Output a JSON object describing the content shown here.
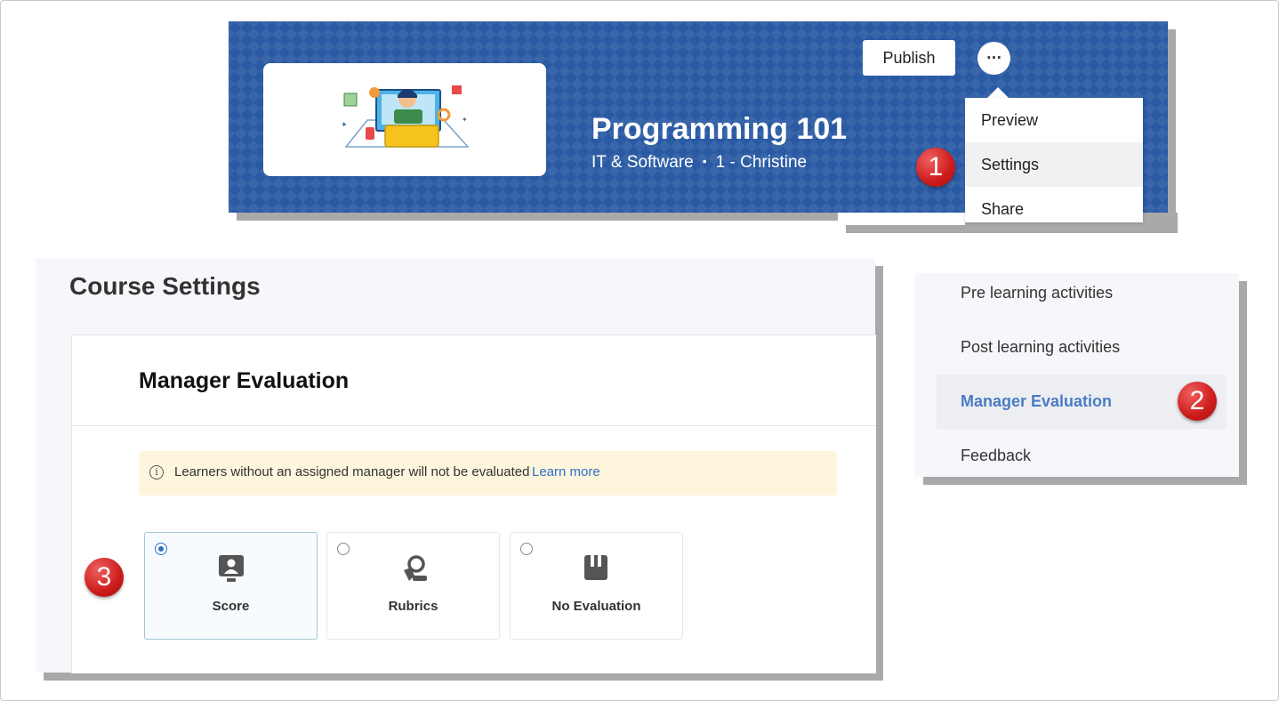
{
  "banner": {
    "title": "Programming 101",
    "category": "IT & Software",
    "separator": "•",
    "author": "1 - Christine",
    "publish_label": "Publish",
    "more_label": "···"
  },
  "dropdown": {
    "items": [
      {
        "label": "Preview"
      },
      {
        "label": "Settings"
      },
      {
        "label": "Share"
      }
    ]
  },
  "markers": [
    "1",
    "2",
    "3"
  ],
  "settings": {
    "title": "Course Settings",
    "section_title": "Manager Evaluation",
    "notice_icon": "i",
    "notice_text": "Learners without an assigned manager will not be evaluated",
    "notice_link": "Learn more",
    "options": [
      {
        "label": "Score",
        "icon": "score-icon",
        "selected": true
      },
      {
        "label": "Rubrics",
        "icon": "rubrics-icon",
        "selected": false
      },
      {
        "label": "No Evaluation",
        "icon": "no-evaluation-icon",
        "selected": false
      }
    ]
  },
  "sidenav": {
    "items": [
      {
        "label": "Pre learning activities"
      },
      {
        "label": "Post learning activities"
      },
      {
        "label": "Manager Evaluation"
      },
      {
        "label": "Feedback"
      }
    ]
  },
  "colors": {
    "banner": "#2a5aa3",
    "accent": "#2f6fc9",
    "active_nav": "#4a7cc4",
    "marker": "#cc1b1b",
    "notice_bg": "#fdf6dd"
  }
}
